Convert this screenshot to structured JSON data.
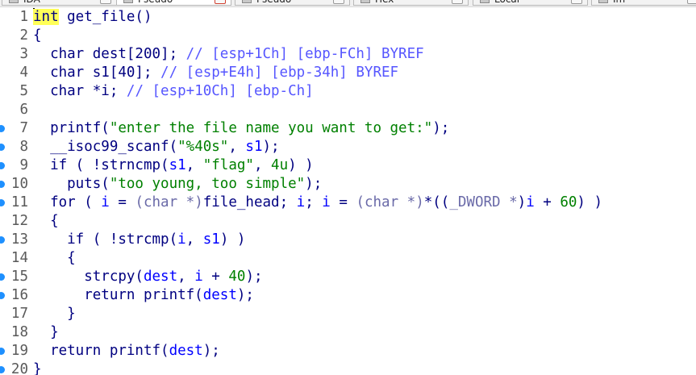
{
  "tabs": [
    {
      "label": "IDA",
      "icon": "ida-view-icon",
      "active": false
    },
    {
      "label": "Pseudo",
      "icon": "pseudocode-icon",
      "active": true
    },
    {
      "label": "Pseudo",
      "icon": "pseudocode-icon",
      "active": false
    },
    {
      "label": "Hex",
      "icon": "hex-view-icon",
      "active": false
    },
    {
      "label": "Local",
      "icon": "local-types-icon",
      "active": false
    },
    {
      "label": "Im",
      "icon": "imports-icon",
      "active": false
    }
  ],
  "code_lines": [
    {
      "n": "1",
      "bp": false,
      "tokens": [
        {
          "c": "hl",
          "t": "int"
        },
        {
          "c": "",
          "t": " get_file()"
        }
      ]
    },
    {
      "n": "2",
      "bp": false,
      "tokens": [
        {
          "c": "",
          "t": "{"
        }
      ]
    },
    {
      "n": "3",
      "bp": false,
      "tokens": [
        {
          "c": "",
          "t": "  char dest[200]; "
        },
        {
          "c": "cm",
          "t": "// [esp+1Ch] [ebp-FCh] BYREF"
        }
      ]
    },
    {
      "n": "4",
      "bp": false,
      "tokens": [
        {
          "c": "",
          "t": "  char s1[40]; "
        },
        {
          "c": "cm",
          "t": "// [esp+E4h] [ebp-34h] BYREF"
        }
      ]
    },
    {
      "n": "5",
      "bp": false,
      "tokens": [
        {
          "c": "",
          "t": "  char *i; "
        },
        {
          "c": "cm",
          "t": "// [esp+10Ch] [ebp-Ch]"
        }
      ]
    },
    {
      "n": "6",
      "bp": false,
      "tokens": []
    },
    {
      "n": "7",
      "bp": true,
      "tokens": [
        {
          "c": "",
          "t": "  printf("
        },
        {
          "c": "str",
          "t": "\"enter the file name you want to get:\""
        },
        {
          "c": "",
          "t": ");"
        }
      ]
    },
    {
      "n": "8",
      "bp": true,
      "tokens": [
        {
          "c": "",
          "t": "  __isoc99_scanf("
        },
        {
          "c": "str",
          "t": "\"%40s\""
        },
        {
          "c": "",
          "t": ", "
        },
        {
          "c": "lv",
          "t": "s1"
        },
        {
          "c": "",
          "t": ");"
        }
      ]
    },
    {
      "n": "9",
      "bp": true,
      "tokens": [
        {
          "c": "",
          "t": "  if ( !strncmp("
        },
        {
          "c": "lv",
          "t": "s1"
        },
        {
          "c": "",
          "t": ", "
        },
        {
          "c": "str",
          "t": "\"flag\""
        },
        {
          "c": "",
          "t": ", "
        },
        {
          "c": "num",
          "t": "4u"
        },
        {
          "c": "",
          "t": ") )"
        }
      ]
    },
    {
      "n": "10",
      "bp": true,
      "tokens": [
        {
          "c": "",
          "t": "    puts("
        },
        {
          "c": "str",
          "t": "\"too young, too simple\""
        },
        {
          "c": "",
          "t": ");"
        }
      ]
    },
    {
      "n": "11",
      "bp": true,
      "tokens": [
        {
          "c": "",
          "t": "  for ( "
        },
        {
          "c": "lv",
          "t": "i"
        },
        {
          "c": "",
          "t": " = "
        },
        {
          "c": "gl",
          "t": "(char *)"
        },
        {
          "c": "",
          "t": "file_head; "
        },
        {
          "c": "lv",
          "t": "i"
        },
        {
          "c": "",
          "t": "; "
        },
        {
          "c": "lv",
          "t": "i"
        },
        {
          "c": "",
          "t": " = "
        },
        {
          "c": "gl",
          "t": "(char *)"
        },
        {
          "c": "",
          "t": "*(("
        },
        {
          "c": "gl",
          "t": "_DWORD *"
        },
        {
          "c": "",
          "t": ")"
        },
        {
          "c": "lv",
          "t": "i"
        },
        {
          "c": "",
          "t": " + "
        },
        {
          "c": "num",
          "t": "60"
        },
        {
          "c": "",
          "t": ") )"
        }
      ]
    },
    {
      "n": "12",
      "bp": false,
      "tokens": [
        {
          "c": "",
          "t": "  {"
        }
      ]
    },
    {
      "n": "13",
      "bp": true,
      "tokens": [
        {
          "c": "",
          "t": "    if ( !strcmp("
        },
        {
          "c": "lv",
          "t": "i"
        },
        {
          "c": "",
          "t": ", "
        },
        {
          "c": "lv",
          "t": "s1"
        },
        {
          "c": "",
          "t": ") )"
        }
      ]
    },
    {
      "n": "14",
      "bp": false,
      "tokens": [
        {
          "c": "",
          "t": "    {"
        }
      ]
    },
    {
      "n": "15",
      "bp": true,
      "tokens": [
        {
          "c": "",
          "t": "      strcpy("
        },
        {
          "c": "lv",
          "t": "dest"
        },
        {
          "c": "",
          "t": ", "
        },
        {
          "c": "lv",
          "t": "i"
        },
        {
          "c": "",
          "t": " + "
        },
        {
          "c": "num",
          "t": "40"
        },
        {
          "c": "",
          "t": ");"
        }
      ]
    },
    {
      "n": "16",
      "bp": true,
      "tokens": [
        {
          "c": "",
          "t": "      return printf("
        },
        {
          "c": "lv",
          "t": "dest"
        },
        {
          "c": "",
          "t": ");"
        }
      ]
    },
    {
      "n": "17",
      "bp": false,
      "tokens": [
        {
          "c": "",
          "t": "    }"
        }
      ]
    },
    {
      "n": "18",
      "bp": false,
      "tokens": [
        {
          "c": "",
          "t": "  }"
        }
      ]
    },
    {
      "n": "19",
      "bp": true,
      "tokens": [
        {
          "c": "",
          "t": "  return printf("
        },
        {
          "c": "lv",
          "t": "dest"
        },
        {
          "c": "",
          "t": ");"
        }
      ]
    },
    {
      "n": "20",
      "bp": true,
      "tokens": [
        {
          "c": "",
          "t": "}"
        }
      ]
    }
  ],
  "colors": {
    "keyword_text": "#000080",
    "comment": "#5656ff",
    "string": "#008000",
    "local_var": "#0000ff",
    "highlight": "#ffff58",
    "breakpoint_dot": "#1e90ff"
  }
}
